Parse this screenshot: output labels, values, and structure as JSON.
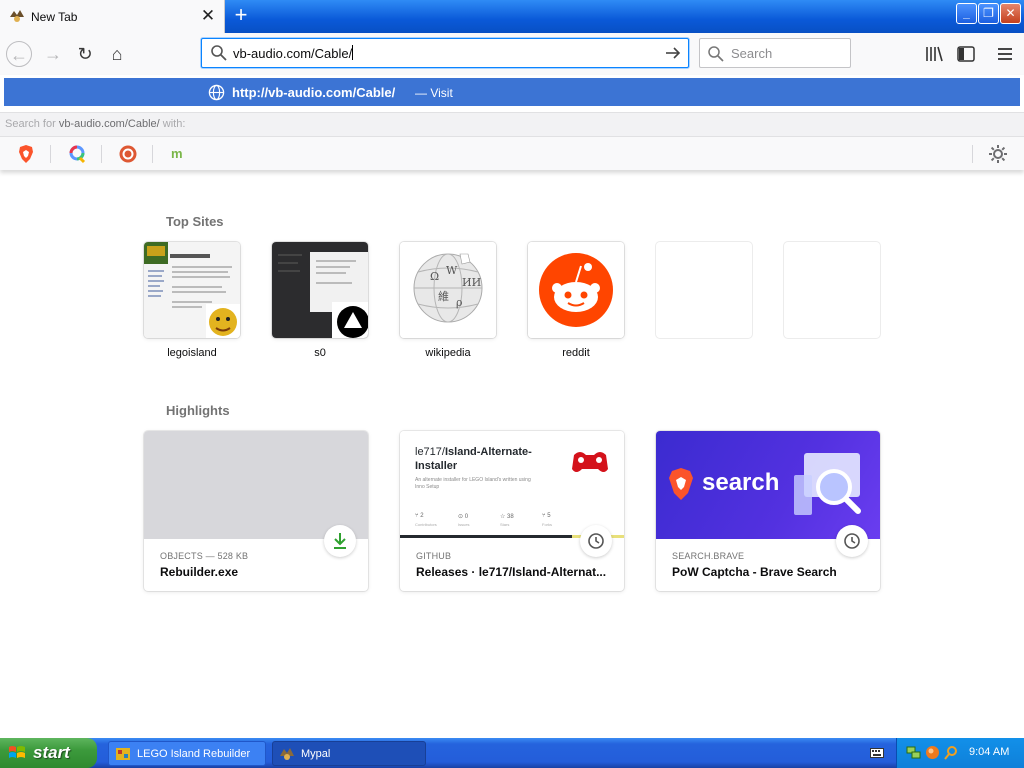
{
  "browser": {
    "tab": {
      "title": "New Tab",
      "close_glyph": "✕"
    },
    "new_tab_glyph": "+",
    "window_buttons": {
      "minimize": "_",
      "maximize": "❐",
      "close": "✕"
    },
    "nav": {
      "back": "←",
      "forward": "→",
      "reload": "↻",
      "home": "⌂"
    },
    "url_input": "vb-audio.com/Cable/",
    "search_placeholder": "Search"
  },
  "dropdown": {
    "visit_url": "http://vb-audio.com/Cable/",
    "visit_suffix": "— Visit",
    "search_with_prefix": "Search for",
    "search_with_term": "vb-audio.com/Cable/",
    "search_with_suffix": "with:",
    "engines": [
      "brave-icon",
      "qwant-icon",
      "duckduckgo-icon",
      "mojeek-icon"
    ],
    "engine_glyphs": {
      "mojeek": "m"
    }
  },
  "newtab": {
    "top_sites_title": "Top Sites",
    "top_sites": [
      {
        "label": "legoisland"
      },
      {
        "label": "s0"
      },
      {
        "label": "wikipedia"
      },
      {
        "label": "reddit"
      },
      {
        "label": ""
      },
      {
        "label": ""
      }
    ],
    "highlights_title": "Highlights",
    "highlights": [
      {
        "context": "OBJECTS — 528 KB",
        "title": "Rebuilder.exe",
        "badge": "download-icon"
      },
      {
        "context": "GITHUB",
        "title": "Releases · le717/Island-Alternat...",
        "badge": "clock-icon",
        "preview": {
          "owner": "le717/",
          "repo": "Island-Alternate-Installer",
          "desc": "An alternate installer for LEGO Island's written using Inno Setup",
          "stats": [
            "2",
            "0",
            "38",
            "5"
          ],
          "stat_labels": [
            "Contributors",
            "Issues",
            "Stars",
            "Forks"
          ]
        }
      },
      {
        "context": "SEARCH.BRAVE",
        "title": "PoW Captcha - Brave Search",
        "badge": "clock-icon",
        "preview": {
          "brand_text": "search"
        }
      }
    ]
  },
  "taskbar": {
    "start_label": "start",
    "tasks": [
      {
        "label": "LEGO Island Rebuilder",
        "active": false
      },
      {
        "label": "Mypal",
        "active": true
      }
    ],
    "clock": "9:04 AM"
  },
  "colors": {
    "accent": "#0a84ff",
    "visit_row": "#3c74d4",
    "reddit": "#ff4500",
    "brave_search_bg": "#4b2adb",
    "download_green": "#2fa12f"
  }
}
